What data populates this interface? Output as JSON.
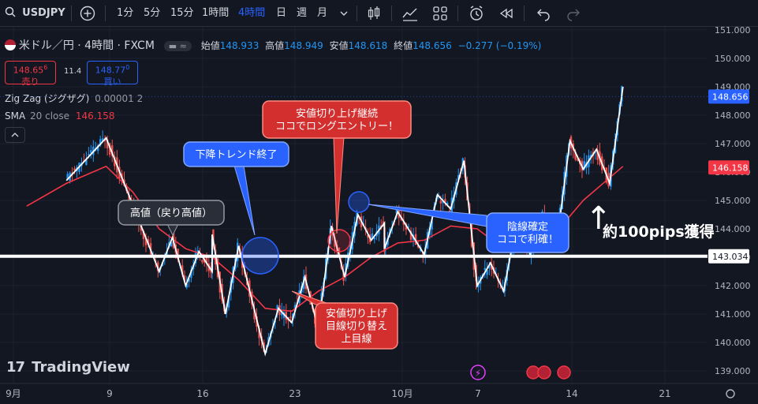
{
  "toolbar": {
    "symbol": "USDJPY",
    "intervals": [
      "1分",
      "5分",
      "15分",
      "1時間",
      "4時間",
      "日",
      "週",
      "月"
    ],
    "active_interval": "4時間"
  },
  "legend": {
    "title": "米ドル／円 · 4時間 · FXCM",
    "open_label": "始値",
    "open": "148.933",
    "high_label": "高値",
    "high": "148.949",
    "low_label": "安値",
    "low": "148.618",
    "close_label": "終値",
    "close": "148.656",
    "change": "−0.277 (−0.19%)",
    "sell_price_main": "148.65",
    "sell_price_sup": "6",
    "sell_label": "売り",
    "spread": "11.4",
    "buy_price_main": "148.77",
    "buy_price_sup": "0",
    "buy_label": "買い",
    "zigzag_label": "Zig Zag (ジグザグ)",
    "zigzag_params": "0.00001 2",
    "sma_label": "SMA",
    "sma_params": "20 close",
    "sma_value": "146.158"
  },
  "colors": {
    "background": "#131722",
    "up": "#2196f3",
    "down": "#ef5350",
    "zigzag": "#ffffff",
    "sma": "#f23645",
    "level": "#ffffff",
    "callout_blue": "#2962ff",
    "callout_red": "#d32f2f",
    "callout_gray": "#2a2e39"
  },
  "chart_data": {
    "type": "candlestick",
    "y_axis_ticks": [
      "151.000",
      "150.000",
      "149.000",
      "148.000",
      "147.000",
      "146.000",
      "145.000",
      "144.000",
      "143.000",
      "142.000",
      "141.000",
      "140.000",
      "139.000"
    ],
    "ylim": [
      138.8,
      151.2
    ],
    "x_axis_ticks": [
      "9月",
      "9",
      "16",
      "23",
      "10月",
      "7",
      "14",
      "21"
    ],
    "price_labels": [
      {
        "value": "148.656",
        "kind": "last"
      },
      {
        "value": "146.158",
        "kind": "sma"
      },
      {
        "value": "143.034",
        "kind": "level"
      }
    ],
    "horizontal_level": 143.034,
    "zigzag": {
      "name": "Zig Zag (ジグザグ)",
      "points": [
        {
          "date": "9/4",
          "value": 145.7
        },
        {
          "date": "9/7",
          "value": 147.2
        },
        {
          "date": "9/11",
          "value": 142.5
        },
        {
          "date": "9/12",
          "value": 143.7
        },
        {
          "date": "9/13",
          "value": 142.0
        },
        {
          "date": "9/14",
          "value": 143.2
        },
        {
          "date": "9/15",
          "value": 142.5
        },
        {
          "date": "9/15",
          "value": 143.8
        },
        {
          "date": "9/16",
          "value": 141.0
        },
        {
          "date": "9/17",
          "value": 143.4
        },
        {
          "date": "9/19",
          "value": 139.6
        },
        {
          "date": "9/20",
          "value": 141.2
        },
        {
          "date": "9/21",
          "value": 140.7
        },
        {
          "date": "9/22",
          "value": 142.3
        },
        {
          "date": "9/23",
          "value": 140.5
        },
        {
          "date": "9/24",
          "value": 144.1
        },
        {
          "date": "9/25",
          "value": 142.3
        },
        {
          "date": "9/26",
          "value": 144.5
        },
        {
          "date": "9/27",
          "value": 143.6
        },
        {
          "date": "9/28",
          "value": 144.2
        },
        {
          "date": "9/28",
          "value": 143.3
        },
        {
          "date": "9/29",
          "value": 144.6
        },
        {
          "date": "10/1",
          "value": 143.1
        },
        {
          "date": "10/2",
          "value": 145.2
        },
        {
          "date": "10/3",
          "value": 144.7
        },
        {
          "date": "10/4",
          "value": 146.4
        },
        {
          "date": "10/5",
          "value": 142.0
        },
        {
          "date": "10/6",
          "value": 142.8
        },
        {
          "date": "10/7",
          "value": 141.8
        },
        {
          "date": "10/8",
          "value": 144.3
        },
        {
          "date": "10/9",
          "value": 143.1
        },
        {
          "date": "10/10",
          "value": 144.5
        },
        {
          "date": "10/11",
          "value": 143.5
        },
        {
          "date": "10/12",
          "value": 147.1
        },
        {
          "date": "10/13",
          "value": 146.1
        },
        {
          "date": "10/14",
          "value": 146.8
        },
        {
          "date": "10/15",
          "value": 145.6
        },
        {
          "date": "10/16",
          "value": 149.0
        }
      ]
    },
    "sma": {
      "name": "SMA 20 close",
      "points": [
        {
          "date": "9/1",
          "value": 144.8
        },
        {
          "date": "9/4",
          "value": 145.6
        },
        {
          "date": "9/7",
          "value": 146.2
        },
        {
          "date": "9/9",
          "value": 145.3
        },
        {
          "date": "9/11",
          "value": 144.0
        },
        {
          "date": "9/13",
          "value": 143.3
        },
        {
          "date": "9/15",
          "value": 143.0
        },
        {
          "date": "9/17",
          "value": 142.2
        },
        {
          "date": "9/19",
          "value": 141.2
        },
        {
          "date": "9/21",
          "value": 141.1
        },
        {
          "date": "9/23",
          "value": 141.8
        },
        {
          "date": "9/25",
          "value": 142.3
        },
        {
          "date": "9/27",
          "value": 143.0
        },
        {
          "date": "9/29",
          "value": 143.5
        },
        {
          "date": "10/1",
          "value": 143.6
        },
        {
          "date": "10/3",
          "value": 144.1
        },
        {
          "date": "10/5",
          "value": 144.0
        },
        {
          "date": "10/7",
          "value": 143.3
        },
        {
          "date": "10/9",
          "value": 143.3
        },
        {
          "date": "10/11",
          "value": 143.9
        },
        {
          "date": "10/13",
          "value": 145.0
        },
        {
          "date": "10/16",
          "value": 146.2
        }
      ]
    }
  },
  "annotations": {
    "callout_high": "高値（戻り高値）",
    "callout_downtrend_end": "下降トレンド終了",
    "callout_long_line1": "安値切り上げ継続",
    "callout_long_line2": "ココでロングエントリー！",
    "callout_switch_line1": "安値切り上げ",
    "callout_switch_line2": "目線切り替え",
    "callout_switch_line3": "上目線",
    "callout_exit_line1": "陰線確定",
    "callout_exit_line2": "ココで利確！",
    "gain_text": "約100pips獲得",
    "gain_arrow": "↑"
  },
  "brand": {
    "name": "TradingView",
    "logo": "17"
  }
}
